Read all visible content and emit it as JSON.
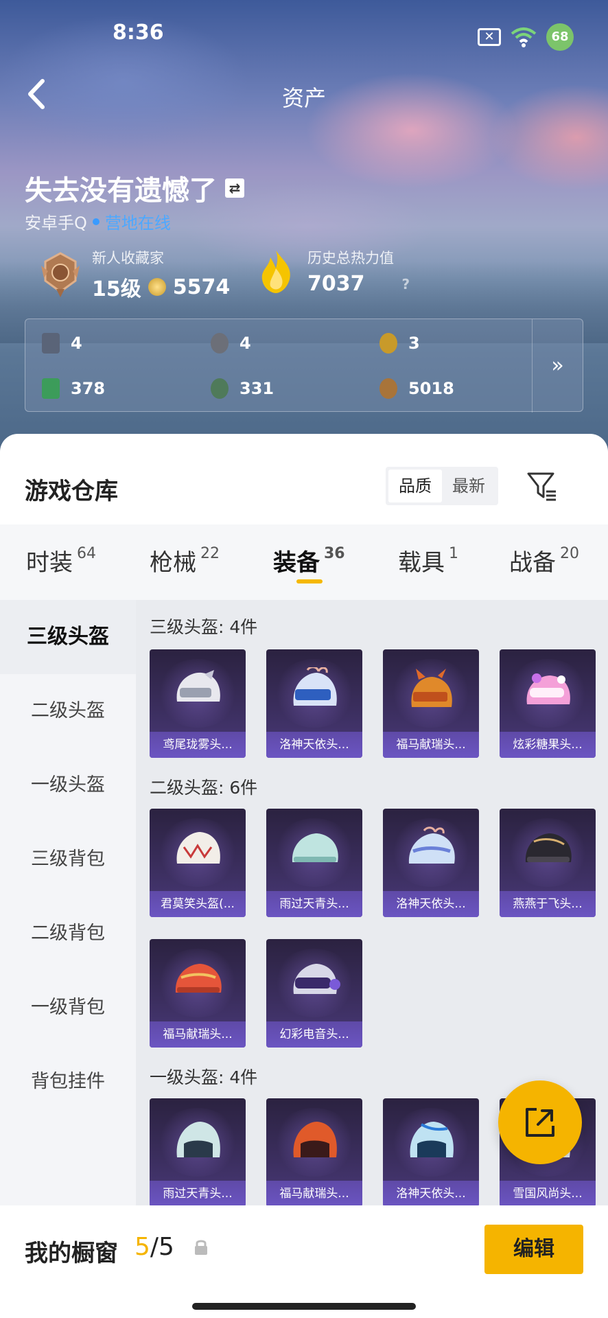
{
  "status_bar": {
    "time": "8:36",
    "battery": "68"
  },
  "nav": {
    "title": "资产"
  },
  "profile": {
    "name": "失去没有遗憾了",
    "platform": "安卓手Q",
    "status": "营地在线"
  },
  "stats": {
    "collector_title": "新人收藏家",
    "level": "15级",
    "coins": "5574",
    "heat_label": "历史总热力值",
    "heat_value": "7037",
    "help": "?"
  },
  "currency": [
    {
      "icon": "card-icon",
      "value": "4",
      "color": "#5a6478"
    },
    {
      "icon": "silver-badge-icon",
      "value": "4",
      "color": "#6c6f78"
    },
    {
      "icon": "gold-badge-icon",
      "value": "3",
      "color": "#c89a2a"
    },
    {
      "icon": "green-ticket-icon",
      "value": "378",
      "color": "#3c9c5a"
    },
    {
      "icon": "green-coin-icon",
      "value": "331",
      "color": "#4f7a5a"
    },
    {
      "icon": "bronze-coin-icon",
      "value": "5018",
      "color": "#a8743a"
    }
  ],
  "warehouse": {
    "title": "游戏仓库",
    "sort_options": [
      "品质",
      "最新"
    ],
    "active_sort": "品质"
  },
  "tabs": [
    {
      "label": "时装",
      "count": "64"
    },
    {
      "label": "枪械",
      "count": "22"
    },
    {
      "label": "装备",
      "count": "36"
    },
    {
      "label": "载具",
      "count": "1"
    },
    {
      "label": "战备",
      "count": "20"
    }
  ],
  "active_tab": "装备",
  "side_menu": [
    "三级头盔",
    "二级头盔",
    "一级头盔",
    "三级背包",
    "二级背包",
    "一级背包",
    "背包挂件"
  ],
  "sections": [
    {
      "title": "三级头盔: 4件",
      "items": [
        "鸢尾珑雾头...",
        "洛神天依头...",
        "福马献瑞头...",
        "炫彩糖果头..."
      ]
    },
    {
      "title": "二级头盔: 6件",
      "items": [
        "君莫笑头盔(...",
        "雨过天青头...",
        "洛神天依头...",
        "燕燕于飞头...",
        "福马献瑞头...",
        "幻彩电音头..."
      ]
    },
    {
      "title": "一级头盔: 4件",
      "items": [
        "雨过天青头...",
        "福马献瑞头...",
        "洛神天依头...",
        "雪国风尚头..."
      ]
    }
  ],
  "showcase": {
    "title": "我的橱窗",
    "current": "5",
    "total": "/5",
    "edit_label": "编辑"
  },
  "colors": {
    "accent": "#f5b400",
    "card_bg": "#3b2e5e",
    "online": "#3a9bff"
  }
}
